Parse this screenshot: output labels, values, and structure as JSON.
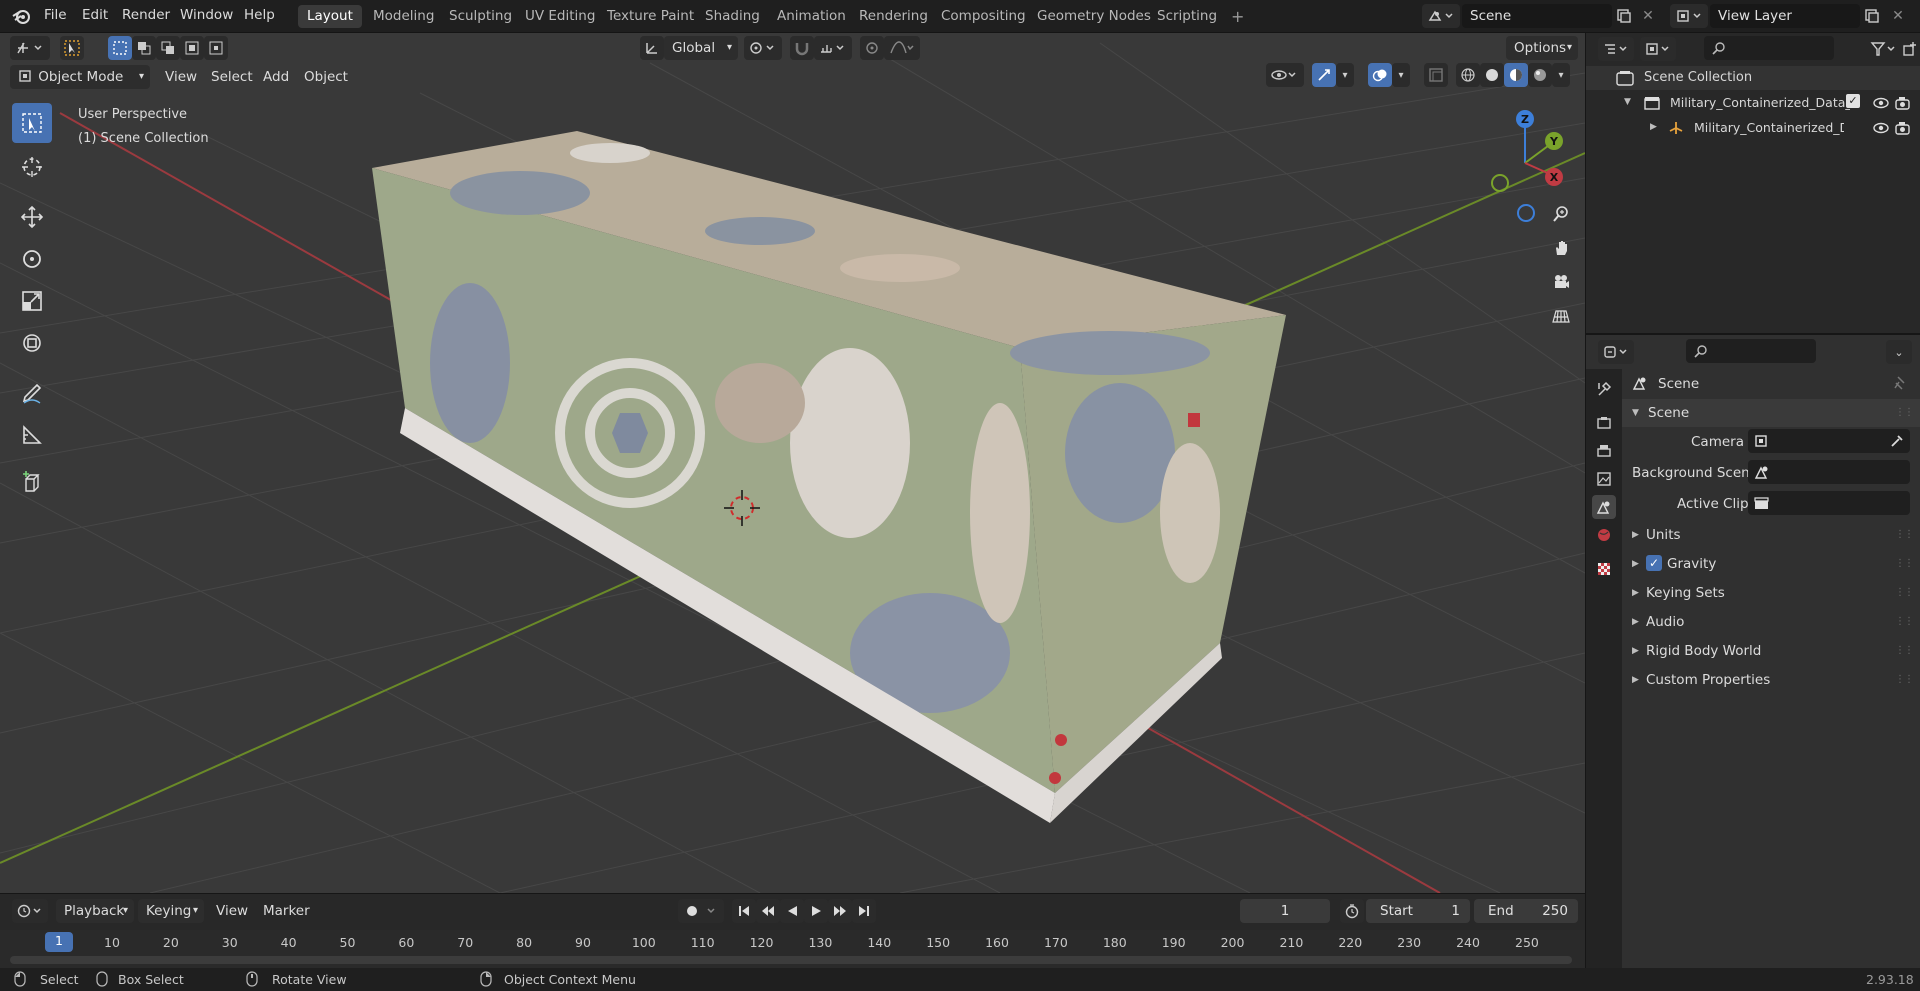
{
  "topbar": {
    "menus": [
      "File",
      "Edit",
      "Render",
      "Window",
      "Help"
    ],
    "workspaces": [
      "Layout",
      "Modeling",
      "Sculpting",
      "UV Editing",
      "Texture Paint",
      "Shading",
      "Animation",
      "Rendering",
      "Compositing",
      "Geometry Nodes",
      "Scripting"
    ],
    "active_workspace": "Layout",
    "add_tab": "+",
    "scene_name": "Scene",
    "view_layer": "View Layer"
  },
  "viewport": {
    "orientation": "Global",
    "options_label": "Options",
    "mode": "Object Mode",
    "menus": [
      "View",
      "Select",
      "Add",
      "Object"
    ],
    "overlay_line1": "User Perspective",
    "overlay_line2": "(1) Scene Collection",
    "gizmo_axes": {
      "x": "X",
      "y": "Y",
      "z": "Z"
    }
  },
  "outliner": {
    "root": "Scene Collection",
    "collection": "Military_Containerized_Data_(",
    "object": "Military_Containerized_D"
  },
  "properties": {
    "context_title": "Scene",
    "panel_title": "Scene",
    "camera_label": "Camera",
    "background_scene_label": "Background Scene",
    "active_clip_label": "Active Clip",
    "panels": [
      "Units",
      "Gravity",
      "Keying Sets",
      "Audio",
      "Rigid Body World",
      "Custom Properties"
    ],
    "gravity_checked": true
  },
  "timeline": {
    "menus": [
      "Playback",
      "Keying",
      "View",
      "Marker"
    ],
    "current_frame": "1",
    "start_label": "Start",
    "start_value": "1",
    "end_label": "End",
    "end_value": "250",
    "ruler": [
      "1",
      "10",
      "20",
      "30",
      "40",
      "50",
      "60",
      "70",
      "80",
      "90",
      "100",
      "110",
      "120",
      "130",
      "140",
      "150",
      "160",
      "170",
      "180",
      "190",
      "200",
      "210",
      "220",
      "230",
      "240",
      "250"
    ]
  },
  "statusbar": {
    "select": "Select",
    "box_select": "Box Select",
    "rotate_view": "Rotate View",
    "context_menu": "Object Context Menu",
    "version": "2.93.18"
  },
  "colors": {
    "accent": "#4772b3",
    "x_axis": "#c03b43",
    "y_axis": "#7aa32b",
    "z_axis": "#3d7fd9"
  }
}
